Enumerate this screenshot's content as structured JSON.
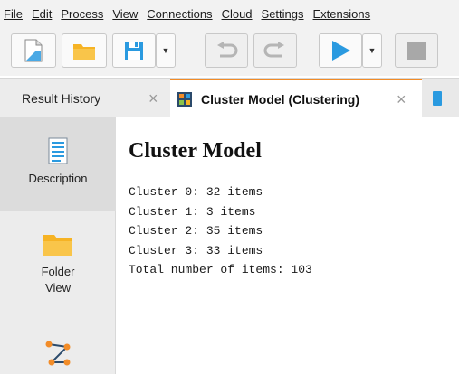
{
  "menu": {
    "file": "File",
    "edit": "Edit",
    "process": "Process",
    "view": "View",
    "connections": "Connections",
    "cloud": "Cloud",
    "settings": "Settings",
    "extensions": "Extensions"
  },
  "toolbar": {
    "new_icon": "new-file-icon",
    "open_icon": "folder-icon",
    "save_icon": "floppy-disk-icon",
    "undo_icon": "undo-icon",
    "redo_icon": "redo-icon",
    "run_icon": "play-icon",
    "stop_icon": "stop-icon",
    "accent_blue": "#2a9ae0",
    "folder_color": "#f6b324"
  },
  "tabs": [
    {
      "label": "Result History",
      "close": "×"
    },
    {
      "label": "Cluster Model (Clustering)",
      "close": "×"
    }
  ],
  "sidebar": {
    "items": [
      {
        "label": "Description"
      },
      {
        "label": "Folder View"
      },
      {
        "label": ""
      }
    ]
  },
  "content": {
    "title": "Cluster Model",
    "lines": [
      "Cluster 0: 32 items",
      "Cluster 1: 3 items",
      "Cluster 2: 35 items",
      "Cluster 3: 33 items",
      "Total number of items: 103"
    ]
  }
}
